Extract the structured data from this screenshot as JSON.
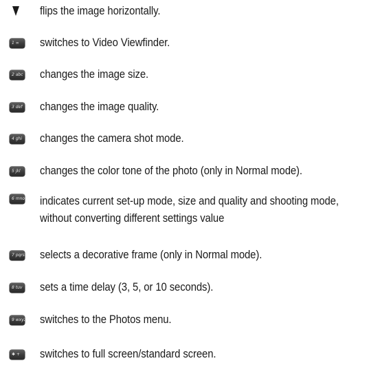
{
  "items": [
    {
      "key": "",
      "icon": "down-arrow-icon",
      "text": "flips the image horizontally."
    },
    {
      "key": "1 ∞",
      "icon": "key-1-icon",
      "text": "switches to Video Viewfinder."
    },
    {
      "key": "2 abc",
      "icon": "key-2-icon",
      "text": "changes the image size."
    },
    {
      "key": "3 def",
      "icon": "key-3-icon",
      "text": "changes the image quality."
    },
    {
      "key": "4 ghi",
      "icon": "key-4-icon",
      "text": "changes the camera shot mode."
    },
    {
      "key": "5 jkl",
      "icon": "key-5-icon",
      "text": "changes the color tone of the photo (only in Normal mode)."
    },
    {
      "key": "6 mno",
      "icon": "key-6-icon",
      "text": "indicates current set-up mode, size and quality and shooting mode, without converting different settings value"
    },
    {
      "key": "7 pqrs",
      "icon": "key-7-icon",
      "text": "selects a decorative frame (only in Normal mode)."
    },
    {
      "key": "8 tuv",
      "icon": "key-8-icon",
      "text": "sets a time delay (3, 5, or 10 seconds)."
    },
    {
      "key": "9 wxyz",
      "icon": "key-9-icon",
      "text": "switches to the Photos menu."
    },
    {
      "key": "✱ +",
      "icon": "key-star-icon",
      "text": "switches to full screen/standard screen."
    }
  ]
}
